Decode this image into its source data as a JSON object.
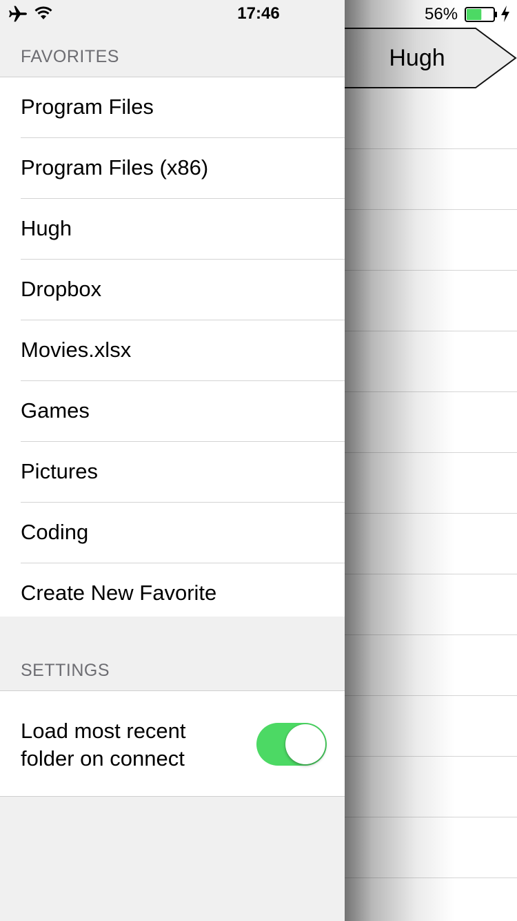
{
  "status_bar": {
    "time": "17:46",
    "battery_percent": "56%",
    "battery_level": 0.56,
    "airplane_icon": "airplane-icon",
    "wifi_icon": "wifi-icon",
    "charging_icon": "charging-bolt-icon"
  },
  "main": {
    "breadcrumb_label": "Hugh"
  },
  "drawer": {
    "favorites_header": "FAVORITES",
    "favorites": [
      {
        "label": "Program Files"
      },
      {
        "label": "Program Files (x86)"
      },
      {
        "label": "Hugh"
      },
      {
        "label": "Dropbox"
      },
      {
        "label": "Movies.xlsx"
      },
      {
        "label": "Games"
      },
      {
        "label": "Pictures"
      },
      {
        "label": "Coding"
      },
      {
        "label": "Create New Favorite"
      }
    ],
    "settings_header": "SETTINGS",
    "settings": {
      "load_recent_label": "Load most recent folder on connect",
      "load_recent_enabled": true
    }
  },
  "colors": {
    "toggle_on": "#4cd964",
    "battery_fill": "#4cd964",
    "drawer_background": "#f0f0f0"
  }
}
